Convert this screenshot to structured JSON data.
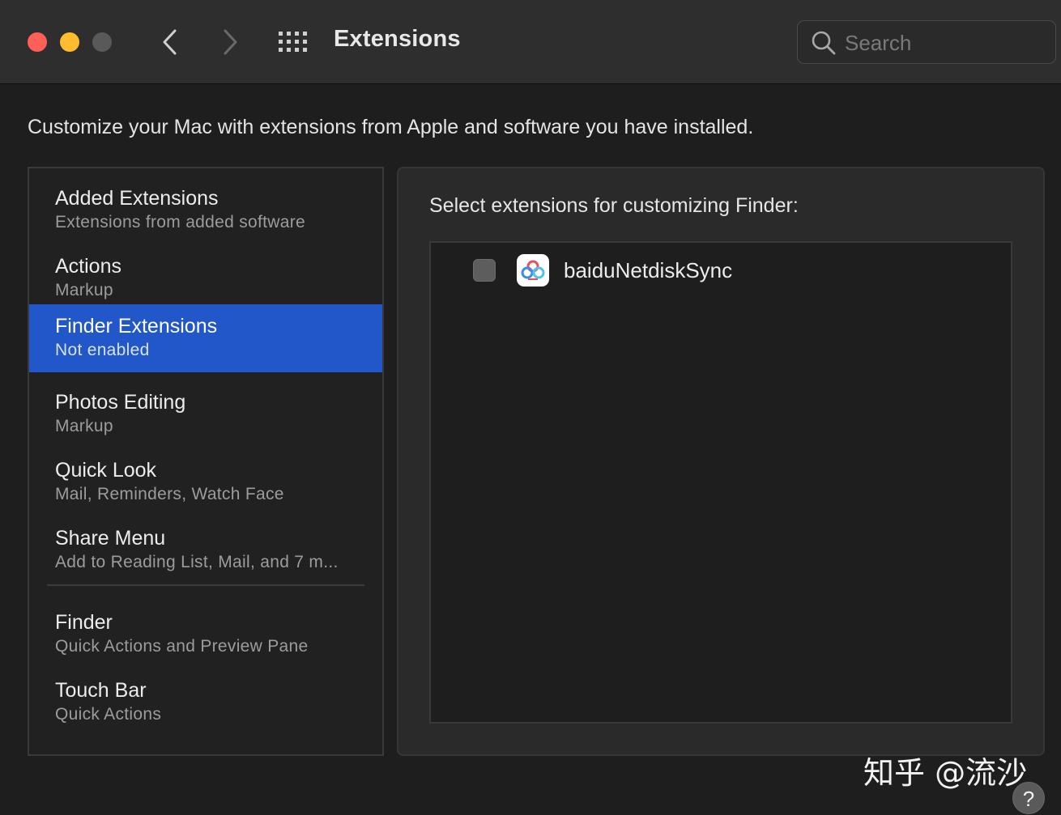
{
  "window": {
    "title": "Extensions",
    "search_placeholder": "Search"
  },
  "description": "Customize your Mac with extensions from Apple and software you have installed.",
  "sidebar": {
    "items": [
      {
        "title": "Added Extensions",
        "subtitle": "Extensions from added software"
      },
      {
        "title": "Actions",
        "subtitle": "Markup"
      },
      {
        "title": "Finder Extensions",
        "subtitle": "Not enabled",
        "selected": true
      },
      {
        "title": "Photos Editing",
        "subtitle": "Markup"
      },
      {
        "title": "Quick Look",
        "subtitle": "Mail, Reminders, Watch Face"
      },
      {
        "title": "Share Menu",
        "subtitle": "Add to Reading List, Mail, and 7 m..."
      },
      {
        "title": "Finder",
        "subtitle": "Quick Actions and Preview Pane"
      },
      {
        "title": "Touch Bar",
        "subtitle": "Quick Actions"
      }
    ]
  },
  "content": {
    "title": "Select extensions for customizing Finder:",
    "extensions": [
      {
        "name": "baiduNetdiskSync",
        "checked": false,
        "icon": "baidu-netdisk-icon"
      }
    ]
  },
  "watermark": "知乎 @流沙",
  "help_label": "?",
  "colors": {
    "selection": "#2257c9",
    "window_bg": "#1e1e1e",
    "close": "#fe5f57",
    "minimize": "#febc2e"
  }
}
